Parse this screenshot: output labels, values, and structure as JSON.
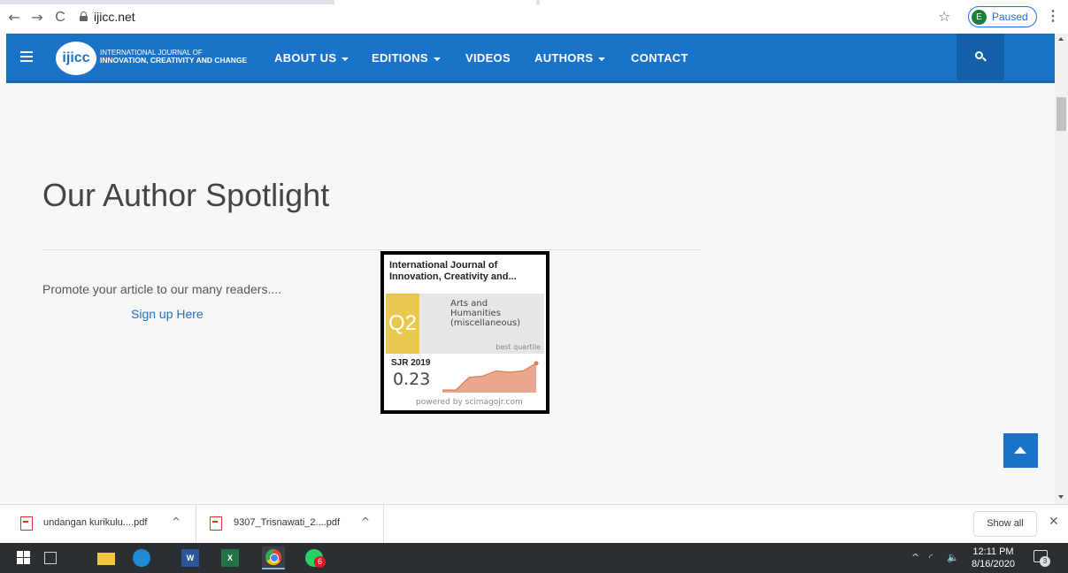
{
  "browser": {
    "back_glyph": "←",
    "forward_glyph": "→",
    "reload_glyph": "C",
    "url": "ijicc.net",
    "star_glyph": "☆",
    "profile_initial": "E",
    "profile_label": "Paused",
    "menu_glyph": "⋮"
  },
  "site": {
    "logo_text": "ijicc",
    "brand_line1": "INTERNATIONAL JOURNAL OF",
    "brand_line2": "INNOVATION, CREATIVITY AND CHANGE",
    "nav": [
      {
        "label": "ABOUT US",
        "dropdown": true
      },
      {
        "label": "EDITIONS",
        "dropdown": true
      },
      {
        "label": "VIDEOS",
        "dropdown": false
      },
      {
        "label": "AUTHORS",
        "dropdown": true
      },
      {
        "label": "CONTACT",
        "dropdown": false
      }
    ],
    "accent_color": "#1a73c8"
  },
  "main": {
    "title": "Our Author Spotlight",
    "promo_text": "Promote your article to our many readers....",
    "signup_link": "Sign up Here"
  },
  "sjr_widget": {
    "journal_line1": "International Journal of",
    "journal_line2": "Innovation, Creativity and...",
    "quartile": "Q2",
    "category_line1": "Arts and",
    "category_line2": "Humanities",
    "category_line3": "(miscellaneous)",
    "best_quartile_label": "best quartile",
    "year_label": "SJR 2019",
    "value": "0.23",
    "powered_by": "powered by scimagojr.com",
    "trend": [
      0.02,
      0.02,
      0.12,
      0.13,
      0.17,
      0.16,
      0.17,
      0.23
    ],
    "quartile_color": "#e8c94d",
    "trend_color": "#e9a88f"
  },
  "downloads": {
    "items": [
      {
        "filename": "undangan kurikulu....pdf"
      },
      {
        "filename": "9307_Trisnawati_2....pdf"
      }
    ],
    "show_all_label": "Show all",
    "close_glyph": "✕"
  },
  "taskbar": {
    "whatsapp_badge": "6",
    "time": "12:11 PM",
    "date": "8/16/2020",
    "notification_count": "3",
    "tray_glyphs": "^",
    "network_glyph": "◜",
    "volume_glyph": "🔈"
  }
}
